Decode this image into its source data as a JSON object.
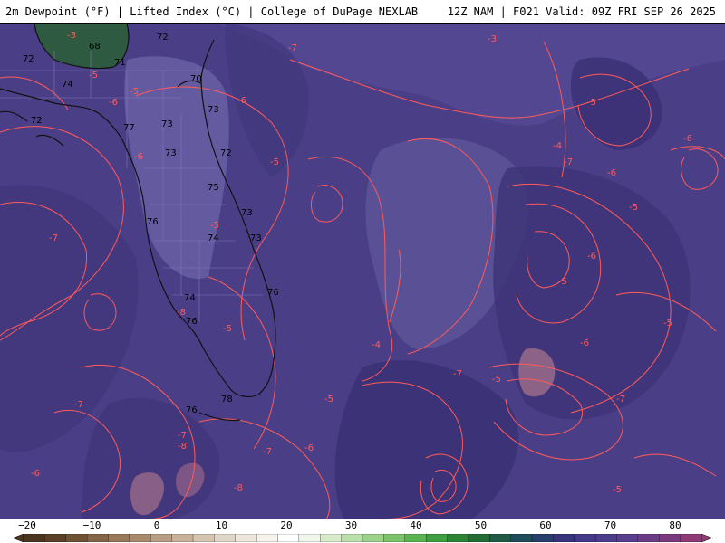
{
  "header": {
    "left_text": "2m Dewpoint (°F) | Lifted Index (°C) | College of DuPage NEXLAB",
    "right_text": "12Z NAM | F021 Valid: 09Z FRI SEP 26 2025"
  },
  "map": {
    "base_color": "#4a3f86",
    "contour_color": "#ff5a5a",
    "coastline_color": "#111111",
    "dewpoint_labels": [
      "70",
      "68",
      "72",
      "72",
      "71",
      "74",
      "70",
      "72",
      "77",
      "73",
      "73",
      "73",
      "72",
      "75",
      "73",
      "74",
      "73",
      "76",
      "74",
      "76",
      "76",
      "78",
      "76"
    ],
    "lifted_index_labels": [
      "-3",
      "-5",
      "-6",
      "-7",
      "-6",
      "-5",
      "-7",
      "-5",
      "-3",
      "-5",
      "-6",
      "-5",
      "-4",
      "-6",
      "-7",
      "-6",
      "-5",
      "-4",
      "-5",
      "-7",
      "-6",
      "-8",
      "-7",
      "-5",
      "-6",
      "-7",
      "-8",
      "-8",
      "-7",
      "-5",
      "-5",
      "-6",
      "-5",
      "-7",
      "-6",
      "-5"
    ]
  },
  "colorbar": {
    "tick_labels": [
      "−20",
      "−10",
      "0",
      "10",
      "20",
      "30",
      "40",
      "50",
      "60",
      "70",
      "80"
    ],
    "colors": [
      "#4a3520",
      "#5a4028",
      "#6e5234",
      "#826446",
      "#96785a",
      "#a88a6c",
      "#b89e84",
      "#c8b29c",
      "#d4c4b0",
      "#e0d6c8",
      "#ece6dc",
      "#f6f2ec",
      "#ffffff",
      "#f0f6ea",
      "#d8eccc",
      "#bce0ac",
      "#9cd28a",
      "#7cc46a",
      "#5cb450",
      "#3e9e40",
      "#2c8436",
      "#246c36",
      "#1e5a44",
      "#1e4c58",
      "#283e6c",
      "#36347a",
      "#443888",
      "#4c3c8c",
      "#583e8c",
      "#6a3c86",
      "#7c3a7e",
      "#8e3a74"
    ]
  }
}
